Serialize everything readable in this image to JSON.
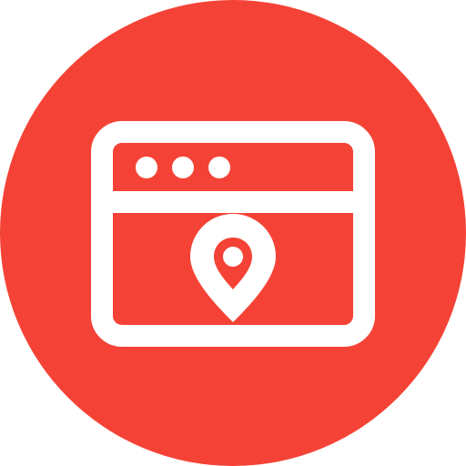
{
  "icon": {
    "name": "browser-location-icon",
    "background_color": "#f44336",
    "foreground_color": "#ffffff",
    "window_dots": 3
  }
}
